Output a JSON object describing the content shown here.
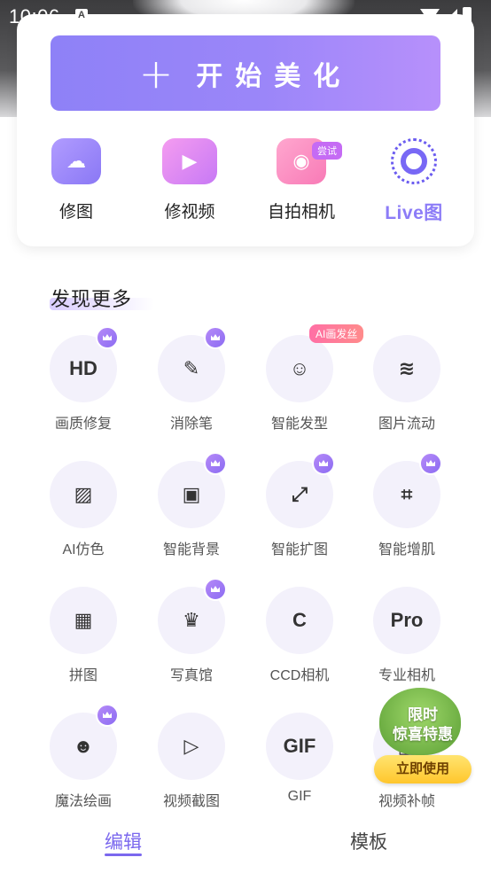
{
  "status": {
    "time": "10:06",
    "notification": "A"
  },
  "card": {
    "start_button": "开始美化",
    "quick_actions": [
      {
        "label": "修图",
        "icon": "photo-icon"
      },
      {
        "label": "修视频",
        "icon": "video-icon"
      },
      {
        "label": "自拍相机",
        "icon": "camera-icon",
        "badge": "尝试"
      },
      {
        "label": "Live图",
        "icon": "live-icon"
      }
    ]
  },
  "discover": {
    "title": "发现更多",
    "ai_badge": "AI画发丝",
    "tools": [
      {
        "label": "画质修复",
        "glyph": "HD",
        "vip": true
      },
      {
        "label": "消除笔",
        "glyph": "✎",
        "vip": true
      },
      {
        "label": "智能发型",
        "glyph": "☺",
        "vip": false
      },
      {
        "label": "图片流动",
        "glyph": "≋",
        "vip": false
      },
      {
        "label": "AI仿色",
        "glyph": "▨",
        "vip": false
      },
      {
        "label": "智能背景",
        "glyph": "▣",
        "vip": true
      },
      {
        "label": "智能扩图",
        "glyph": "⤢",
        "vip": true
      },
      {
        "label": "智能增肌",
        "glyph": "⌗",
        "vip": true
      },
      {
        "label": "拼图",
        "glyph": "▦",
        "vip": false
      },
      {
        "label": "写真馆",
        "glyph": "♛",
        "vip": true
      },
      {
        "label": "CCD相机",
        "glyph": "C",
        "vip": false
      },
      {
        "label": "专业相机",
        "glyph": "Pro",
        "vip": false
      },
      {
        "label": "魔法绘画",
        "glyph": "☻",
        "vip": true
      },
      {
        "label": "视频截图",
        "glyph": "▷",
        "vip": false
      },
      {
        "label": "GIF",
        "glyph": "GIF",
        "vip": false
      },
      {
        "label": "视频补帧",
        "glyph": "▤",
        "vip": false
      }
    ]
  },
  "promo": {
    "line1": "限时",
    "line2": "惊喜特惠",
    "button": "立即使用"
  },
  "tabs": [
    {
      "label": "编辑",
      "active": true
    },
    {
      "label": "模板",
      "active": false
    }
  ],
  "colors": {
    "accent": "#7b68ee",
    "vip": "#9a74f5",
    "ai_badge": "#ff6fa5"
  }
}
